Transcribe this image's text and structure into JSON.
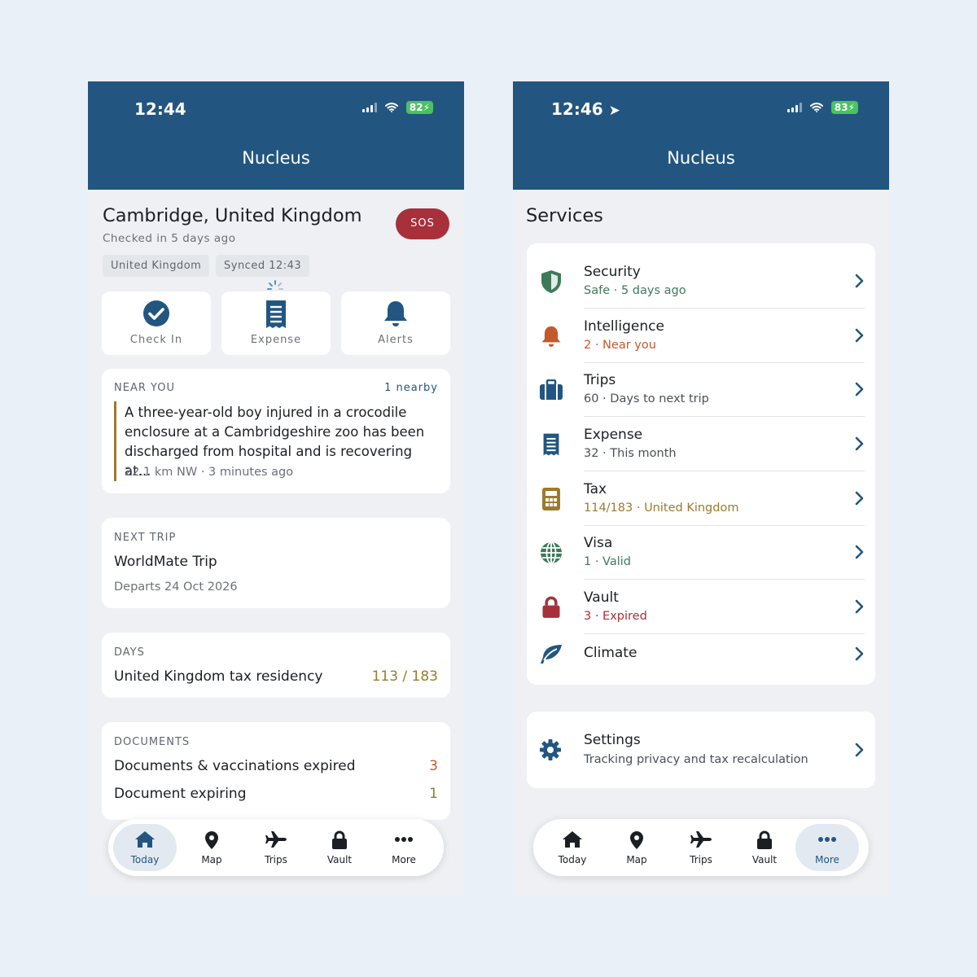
{
  "left": {
    "clock": "12:44",
    "battery": "82",
    "app_title": "Nucleus",
    "location": {
      "title": "Cambridge, United Kingdom",
      "checked_in": "Checked in 5 days ago",
      "sos": "SOS"
    },
    "chips": [
      "United Kingdom",
      "Synced 12:43"
    ],
    "actions": [
      "Check In",
      "Expense",
      "Alerts"
    ],
    "near_you": {
      "label": "NEAR YOU",
      "count": "1 nearby",
      "headline": "A three-year-old boy injured in a crocodile enclosure at a Cambridgeshire zoo has been discharged from hospital and is recovering at...",
      "meta": "22.1 km NW · 3 minutes ago"
    },
    "next_trip": {
      "label": "NEXT TRIP",
      "name": "WorldMate Trip",
      "departs": "Departs 24 Oct 2026"
    },
    "days": {
      "label": "DAYS",
      "item": "United Kingdom tax residency",
      "value": "113 / 183"
    },
    "documents": {
      "label": "DOCUMENTS",
      "rows": [
        {
          "label": "Documents & vaccinations expired",
          "count": "3"
        },
        {
          "label": "Document expiring",
          "count": "1"
        }
      ]
    }
  },
  "right": {
    "clock": "12:46",
    "battery": "83",
    "app_title": "Nucleus",
    "section_title": "Services",
    "services": [
      {
        "title": "Security",
        "subtitle": "Safe · 5 days ago",
        "icon": "shield-icon",
        "color": "#3e7a5a"
      },
      {
        "title": "Intelligence",
        "subtitle": "2 · Near you",
        "icon": "bell-icon",
        "color": "#c45a2a"
      },
      {
        "title": "Trips",
        "subtitle": "60 · Days to next trip",
        "icon": "suitcase-icon",
        "color": "#2e3a44"
      },
      {
        "title": "Expense",
        "subtitle": "32 · This month",
        "icon": "receipt-icon",
        "color": "#2e3a44"
      },
      {
        "title": "Tax",
        "subtitle": "114/183 · United Kingdom",
        "icon": "calculator-icon",
        "color": "#9c7a2c"
      },
      {
        "title": "Visa",
        "subtitle": "1 · Valid",
        "icon": "globe-icon",
        "color": "#3e7a5a"
      },
      {
        "title": "Vault",
        "subtitle": "3 · Expired",
        "icon": "lock-icon",
        "color": "#a7303a"
      },
      {
        "title": "Climate",
        "subtitle": "",
        "icon": "leaf-icon",
        "color": "#2e3a44"
      }
    ],
    "settings": {
      "title": "Settings",
      "subtitle": "Tracking privacy and tax recalculation"
    }
  },
  "nav": [
    "Today",
    "Map",
    "Trips",
    "Vault",
    "More"
  ],
  "colors": {
    "brand": "#225681",
    "sos": "#a7303a",
    "accent_gold": "#9c7a2c",
    "badge_green": "#4bc260"
  }
}
